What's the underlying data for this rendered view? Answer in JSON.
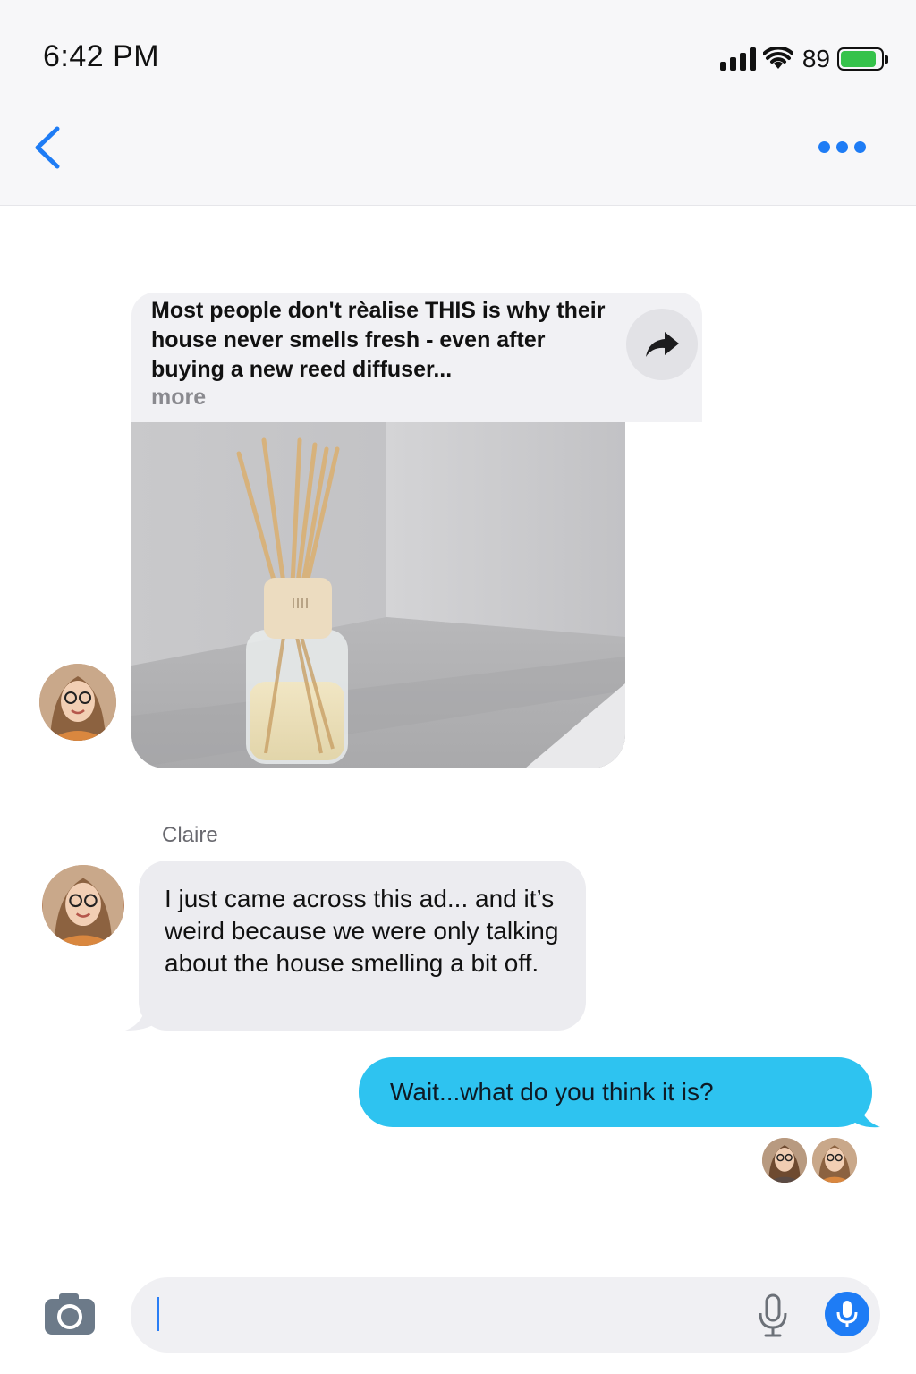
{
  "status_bar": {
    "time": "6:42 PM",
    "battery_percent": "89",
    "battery_level": 0.89,
    "signal_bars": 4
  },
  "header": {
    "back_icon": "chevron-left-icon",
    "more_icon": "ellipsis-icon"
  },
  "ad_card": {
    "text": "Most people don't rèalise THIS is why their house never smells fresh - even after buying a new reed diffuser...",
    "more_label": "more",
    "share_icon": "share-arrow-icon",
    "image_subject": "reed-diffuser-image"
  },
  "conversation": {
    "sender_name": "Claire",
    "incoming_message": "I just came across this ad... and it’s weird because we were only talking about the house smelling a bit off.",
    "outgoing_message": "Wait...what do you think it is?"
  },
  "composer": {
    "camera_icon": "camera-icon",
    "dictation_icon": "microphone-icon",
    "voice_button_icon": "microphone-icon"
  },
  "colors": {
    "accent": "#1e7cf5",
    "outgoing_bubble": "#2ec3f0",
    "incoming_bubble": "#ececf0",
    "battery": "#35c24a"
  }
}
